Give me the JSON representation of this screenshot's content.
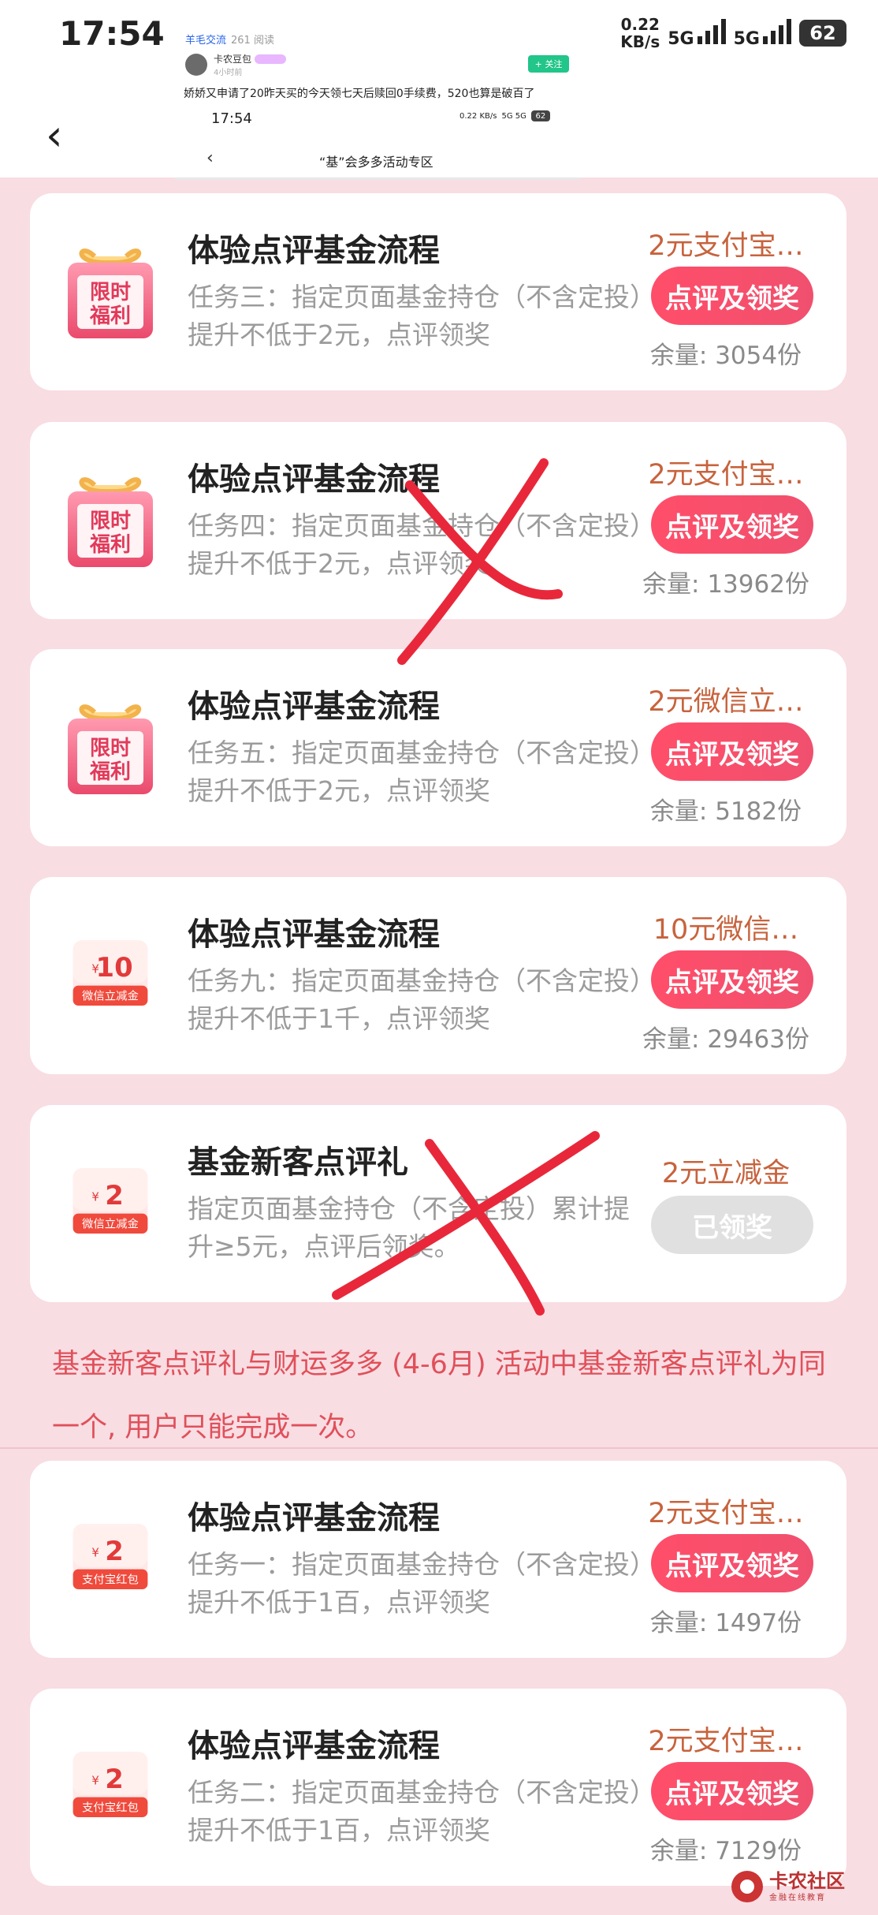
{
  "status_bar": {
    "time": "17:54",
    "speed_value": "0.22",
    "speed_unit": "KB/s",
    "net1": "5G",
    "net2": "5G",
    "battery": "62"
  },
  "post": {
    "forum": "羊毛交流",
    "reads": "261 阅读",
    "author": "卡农豆包",
    "time_ago": "4小时前",
    "follow": "+ 关注",
    "text": "娇娇又申请了20昨天买的今天领七天后赎回0手续费，520也算是破百了"
  },
  "inner": {
    "time": "17:54",
    "speed": "0.22 KB/s",
    "net": "5G 5G",
    "battery": "62",
    "title": "“基”会多多活动专区"
  },
  "cards": [
    {
      "icon": "gift",
      "icon_text1": "限时",
      "icon_text2": "福利",
      "title": "体验点评基金流程",
      "desc": "任务三：指定页面基金持仓（不含定投）提升不低于2元，点评领奖",
      "reward": "2元支付宝…",
      "button": "点评及领奖",
      "stock": "余量: 3054份"
    },
    {
      "icon": "gift",
      "icon_text1": "限时",
      "icon_text2": "福利",
      "title": "体验点评基金流程",
      "desc": "任务四：指定页面基金持仓（不含定投）提升不低于2元，点评领奖",
      "reward": "2元支付宝…",
      "button": "点评及领奖",
      "stock": "余量: 13962份"
    },
    {
      "icon": "gift",
      "icon_text1": "限时",
      "icon_text2": "福利",
      "title": "体验点评基金流程",
      "desc": "任务五：指定页面基金持仓（不含定投）提升不低于2元，点评领奖",
      "reward": "2元微信立…",
      "button": "点评及领奖",
      "stock": "余量: 5182份"
    },
    {
      "icon": "coupon",
      "amount": "10",
      "coupon_label": "微信立减金",
      "title": "体验点评基金流程",
      "desc": "任务九：指定页面基金持仓（不含定投）提升不低于1千，点评领奖",
      "reward": "10元微信…",
      "button": "点评及领奖",
      "stock": "余量: 29463份"
    },
    {
      "icon": "coupon",
      "amount": "2",
      "coupon_label": "微信立减金",
      "title": "基金新客点评礼",
      "desc": "指定页面基金持仓（不含定投）累计提升≥5元，点评后领奖。",
      "reward": "2元立减金",
      "button": "已领奖",
      "stock": ""
    },
    {
      "icon": "coupon",
      "amount": "2",
      "coupon_label": "支付宝红包",
      "title": "体验点评基金流程",
      "desc": "任务一：指定页面基金持仓（不含定投）提升不低于1百，点评领奖",
      "reward": "2元支付宝…",
      "button": "点评及领奖",
      "stock": "余量: 1497份"
    },
    {
      "icon": "coupon",
      "amount": "2",
      "coupon_label": "支付宝红包",
      "title": "体验点评基金流程",
      "desc": "任务二：指定页面基金持仓（不含定投）提升不低于1百，点评领奖",
      "reward": "2元支付宝…",
      "button": "点评及领奖",
      "stock": "余量: 7129份"
    }
  ],
  "note": "基金新客点评礼与财运多多 (4-6月) 活动中基金新客点评礼为同一个, 用户只能完成一次。",
  "watermark": {
    "name": "卡农社区",
    "sub": "金融在线教育"
  },
  "colors": {
    "accent": "#f0506e",
    "background": "#f8dde3",
    "reward": "#c7633d",
    "note": "#e0505a",
    "cross": "#e8283a"
  }
}
